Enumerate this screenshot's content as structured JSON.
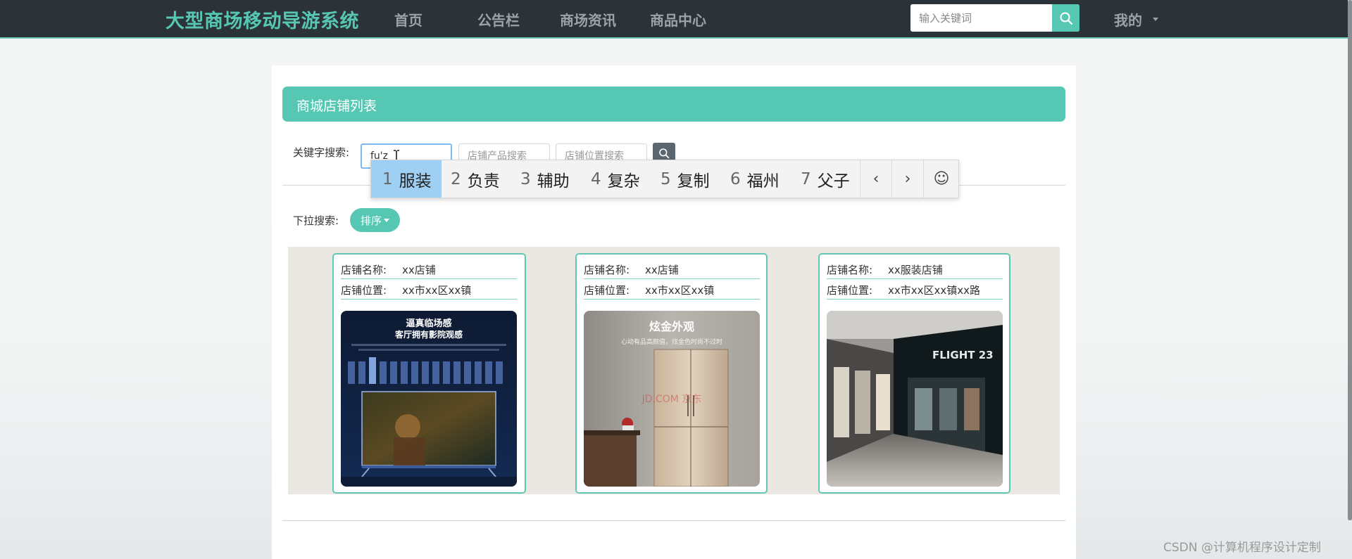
{
  "nav": {
    "brand": "大型商场移动导游系统",
    "items": [
      "首页",
      "公告栏",
      "商场资讯",
      "商品中心"
    ],
    "search_placeholder": "输入关键词",
    "me": "我的"
  },
  "panel": {
    "title": "商城店铺列表",
    "keyword_label": "关键字搜索:",
    "keyword_value": "fu'z",
    "product_placeholder": "店铺产品搜索",
    "location_placeholder": "店铺位置搜索",
    "dropdown_label": "下拉搜索:",
    "sort_label": "排序"
  },
  "cards": [
    {
      "name_key": "店铺名称:",
      "name": "xx店铺",
      "loc_key": "店铺位置:",
      "loc": "xx市xx区xx镇",
      "image": "tv-promo",
      "img_title": "逼真临场感",
      "img_subtitle": "客厅拥有影院观感"
    },
    {
      "name_key": "店铺名称:",
      "name": "xx店铺",
      "loc_key": "店铺位置:",
      "loc": "xx市xx区xx镇",
      "image": "fridge-promo",
      "img_title": "炫金外观",
      "img_subtitle": "心动有品高颜值，炫金色时尚不过时"
    },
    {
      "name_key": "店铺名称:",
      "name": "xx服装店铺",
      "loc_key": "店铺位置:",
      "loc": "xx市xx区xx镇xx路",
      "image": "storefront",
      "img_title": "FLIGHT 23"
    }
  ],
  "ime": {
    "candidates": [
      {
        "n": "1",
        "t": "服装"
      },
      {
        "n": "2",
        "t": "负责"
      },
      {
        "n": "3",
        "t": "辅助"
      },
      {
        "n": "4",
        "t": "复杂"
      },
      {
        "n": "5",
        "t": "复制"
      },
      {
        "n": "6",
        "t": "福州"
      },
      {
        "n": "7",
        "t": "父子"
      }
    ],
    "prev": "‹",
    "next": "›",
    "emoji": "☺"
  },
  "watermark": "CSDN @计算机程序设计定制",
  "colors": {
    "accent": "#56c7b3",
    "nav_bg": "#2c3338",
    "ime_selected": "#9fcff3"
  }
}
